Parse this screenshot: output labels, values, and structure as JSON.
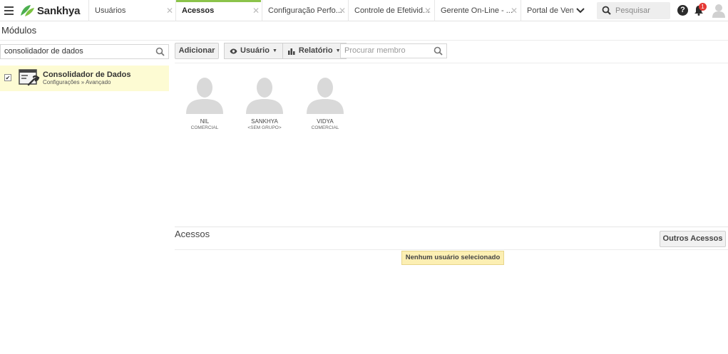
{
  "topbar": {
    "brand": "Sankhya",
    "tabs": [
      {
        "label": "Usuários"
      },
      {
        "label": "Acessos"
      },
      {
        "label": "Configuração Perfo..."
      },
      {
        "label": "Controle de Efetivid..."
      },
      {
        "label": "Gerente On-Line - ..."
      },
      {
        "label": "Portal de Vend"
      }
    ],
    "search_placeholder": "Pesquisar",
    "help_label": "?",
    "notification_count": "1"
  },
  "page_title": "Módulos",
  "modules": {
    "filter_value": "consolidador de dados",
    "items": [
      {
        "name": "Consolidador de Dados",
        "path": "Configurações » Avançado"
      }
    ]
  },
  "toolbar": {
    "add_label": "Adicionar",
    "user_label": "Usuário",
    "report_label": "Relatório",
    "member_search_placeholder": "Procurar membro"
  },
  "members": [
    {
      "name": "NIL",
      "group": "COMERCIAL"
    },
    {
      "name": "SANKHYA",
      "group": "<SEM GRUPO>"
    },
    {
      "name": "VIDYA",
      "group": "COMERCIAL"
    }
  ],
  "access_section": {
    "title": "Acessos",
    "other_access_label": "Outros Acessos",
    "empty_notice": "Nenhum usuário selecionado"
  },
  "colors": {
    "accent": "#8bc34a",
    "selected_row": "#fdfbd3",
    "notice_bg": "#fcefb3",
    "badge": "#e53935"
  }
}
